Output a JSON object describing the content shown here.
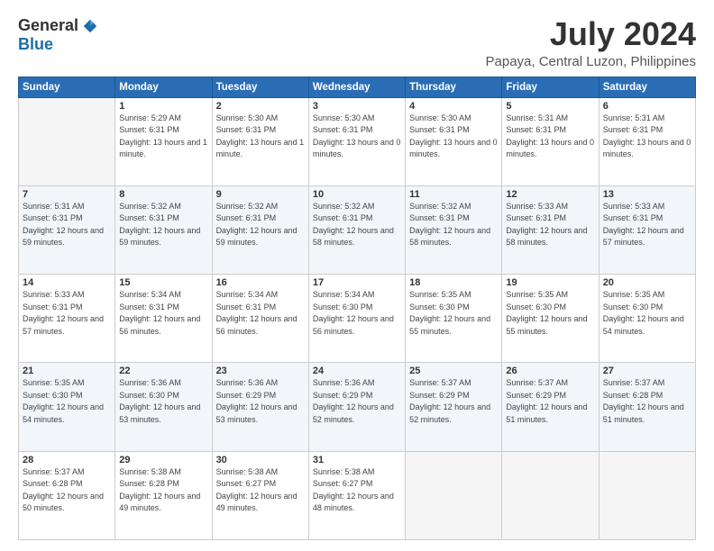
{
  "logo": {
    "general": "General",
    "blue": "Blue"
  },
  "title": {
    "month_year": "July 2024",
    "location": "Papaya, Central Luzon, Philippines"
  },
  "headers": [
    "Sunday",
    "Monday",
    "Tuesday",
    "Wednesday",
    "Thursday",
    "Friday",
    "Saturday"
  ],
  "weeks": [
    [
      {
        "day": "",
        "sunrise": "",
        "sunset": "",
        "daylight": "",
        "empty": true
      },
      {
        "day": "1",
        "sunrise": "Sunrise: 5:29 AM",
        "sunset": "Sunset: 6:31 PM",
        "daylight": "Daylight: 13 hours and 1 minute.",
        "empty": false
      },
      {
        "day": "2",
        "sunrise": "Sunrise: 5:30 AM",
        "sunset": "Sunset: 6:31 PM",
        "daylight": "Daylight: 13 hours and 1 minute.",
        "empty": false
      },
      {
        "day": "3",
        "sunrise": "Sunrise: 5:30 AM",
        "sunset": "Sunset: 6:31 PM",
        "daylight": "Daylight: 13 hours and 0 minutes.",
        "empty": false
      },
      {
        "day": "4",
        "sunrise": "Sunrise: 5:30 AM",
        "sunset": "Sunset: 6:31 PM",
        "daylight": "Daylight: 13 hours and 0 minutes.",
        "empty": false
      },
      {
        "day": "5",
        "sunrise": "Sunrise: 5:31 AM",
        "sunset": "Sunset: 6:31 PM",
        "daylight": "Daylight: 13 hours and 0 minutes.",
        "empty": false
      },
      {
        "day": "6",
        "sunrise": "Sunrise: 5:31 AM",
        "sunset": "Sunset: 6:31 PM",
        "daylight": "Daylight: 13 hours and 0 minutes.",
        "empty": false
      }
    ],
    [
      {
        "day": "7",
        "sunrise": "Sunrise: 5:31 AM",
        "sunset": "Sunset: 6:31 PM",
        "daylight": "Daylight: 12 hours and 59 minutes.",
        "empty": false
      },
      {
        "day": "8",
        "sunrise": "Sunrise: 5:32 AM",
        "sunset": "Sunset: 6:31 PM",
        "daylight": "Daylight: 12 hours and 59 minutes.",
        "empty": false
      },
      {
        "day": "9",
        "sunrise": "Sunrise: 5:32 AM",
        "sunset": "Sunset: 6:31 PM",
        "daylight": "Daylight: 12 hours and 59 minutes.",
        "empty": false
      },
      {
        "day": "10",
        "sunrise": "Sunrise: 5:32 AM",
        "sunset": "Sunset: 6:31 PM",
        "daylight": "Daylight: 12 hours and 58 minutes.",
        "empty": false
      },
      {
        "day": "11",
        "sunrise": "Sunrise: 5:32 AM",
        "sunset": "Sunset: 6:31 PM",
        "daylight": "Daylight: 12 hours and 58 minutes.",
        "empty": false
      },
      {
        "day": "12",
        "sunrise": "Sunrise: 5:33 AM",
        "sunset": "Sunset: 6:31 PM",
        "daylight": "Daylight: 12 hours and 58 minutes.",
        "empty": false
      },
      {
        "day": "13",
        "sunrise": "Sunrise: 5:33 AM",
        "sunset": "Sunset: 6:31 PM",
        "daylight": "Daylight: 12 hours and 57 minutes.",
        "empty": false
      }
    ],
    [
      {
        "day": "14",
        "sunrise": "Sunrise: 5:33 AM",
        "sunset": "Sunset: 6:31 PM",
        "daylight": "Daylight: 12 hours and 57 minutes.",
        "empty": false
      },
      {
        "day": "15",
        "sunrise": "Sunrise: 5:34 AM",
        "sunset": "Sunset: 6:31 PM",
        "daylight": "Daylight: 12 hours and 56 minutes.",
        "empty": false
      },
      {
        "day": "16",
        "sunrise": "Sunrise: 5:34 AM",
        "sunset": "Sunset: 6:31 PM",
        "daylight": "Daylight: 12 hours and 56 minutes.",
        "empty": false
      },
      {
        "day": "17",
        "sunrise": "Sunrise: 5:34 AM",
        "sunset": "Sunset: 6:30 PM",
        "daylight": "Daylight: 12 hours and 56 minutes.",
        "empty": false
      },
      {
        "day": "18",
        "sunrise": "Sunrise: 5:35 AM",
        "sunset": "Sunset: 6:30 PM",
        "daylight": "Daylight: 12 hours and 55 minutes.",
        "empty": false
      },
      {
        "day": "19",
        "sunrise": "Sunrise: 5:35 AM",
        "sunset": "Sunset: 6:30 PM",
        "daylight": "Daylight: 12 hours and 55 minutes.",
        "empty": false
      },
      {
        "day": "20",
        "sunrise": "Sunrise: 5:35 AM",
        "sunset": "Sunset: 6:30 PM",
        "daylight": "Daylight: 12 hours and 54 minutes.",
        "empty": false
      }
    ],
    [
      {
        "day": "21",
        "sunrise": "Sunrise: 5:35 AM",
        "sunset": "Sunset: 6:30 PM",
        "daylight": "Daylight: 12 hours and 54 minutes.",
        "empty": false
      },
      {
        "day": "22",
        "sunrise": "Sunrise: 5:36 AM",
        "sunset": "Sunset: 6:30 PM",
        "daylight": "Daylight: 12 hours and 53 minutes.",
        "empty": false
      },
      {
        "day": "23",
        "sunrise": "Sunrise: 5:36 AM",
        "sunset": "Sunset: 6:29 PM",
        "daylight": "Daylight: 12 hours and 53 minutes.",
        "empty": false
      },
      {
        "day": "24",
        "sunrise": "Sunrise: 5:36 AM",
        "sunset": "Sunset: 6:29 PM",
        "daylight": "Daylight: 12 hours and 52 minutes.",
        "empty": false
      },
      {
        "day": "25",
        "sunrise": "Sunrise: 5:37 AM",
        "sunset": "Sunset: 6:29 PM",
        "daylight": "Daylight: 12 hours and 52 minutes.",
        "empty": false
      },
      {
        "day": "26",
        "sunrise": "Sunrise: 5:37 AM",
        "sunset": "Sunset: 6:29 PM",
        "daylight": "Daylight: 12 hours and 51 minutes.",
        "empty": false
      },
      {
        "day": "27",
        "sunrise": "Sunrise: 5:37 AM",
        "sunset": "Sunset: 6:28 PM",
        "daylight": "Daylight: 12 hours and 51 minutes.",
        "empty": false
      }
    ],
    [
      {
        "day": "28",
        "sunrise": "Sunrise: 5:37 AM",
        "sunset": "Sunset: 6:28 PM",
        "daylight": "Daylight: 12 hours and 50 minutes.",
        "empty": false
      },
      {
        "day": "29",
        "sunrise": "Sunrise: 5:38 AM",
        "sunset": "Sunset: 6:28 PM",
        "daylight": "Daylight: 12 hours and 49 minutes.",
        "empty": false
      },
      {
        "day": "30",
        "sunrise": "Sunrise: 5:38 AM",
        "sunset": "Sunset: 6:27 PM",
        "daylight": "Daylight: 12 hours and 49 minutes.",
        "empty": false
      },
      {
        "day": "31",
        "sunrise": "Sunrise: 5:38 AM",
        "sunset": "Sunset: 6:27 PM",
        "daylight": "Daylight: 12 hours and 48 minutes.",
        "empty": false
      },
      {
        "day": "",
        "sunrise": "",
        "sunset": "",
        "daylight": "",
        "empty": true
      },
      {
        "day": "",
        "sunrise": "",
        "sunset": "",
        "daylight": "",
        "empty": true
      },
      {
        "day": "",
        "sunrise": "",
        "sunset": "",
        "daylight": "",
        "empty": true
      }
    ]
  ]
}
